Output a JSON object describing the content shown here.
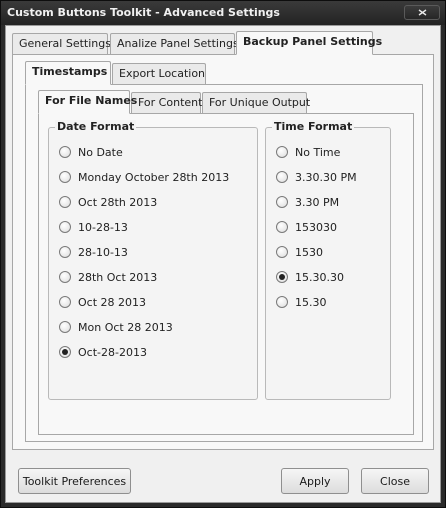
{
  "window": {
    "title": "Custom Buttons Toolkit - Advanced Settings",
    "close_icon": "close-icon"
  },
  "main_tabs": [
    {
      "label": "General Settings",
      "active": false
    },
    {
      "label": "Analize Panel Settings",
      "active": false
    },
    {
      "label": "Backup Panel Settings",
      "active": true
    }
  ],
  "sub_tabs": [
    {
      "label": "Timestamps",
      "active": true
    },
    {
      "label": "Export Location",
      "active": false
    }
  ],
  "inner_tabs": [
    {
      "label": "For File Names",
      "active": true
    },
    {
      "label": "For Content",
      "active": false
    },
    {
      "label": "For Unique Output",
      "active": false
    }
  ],
  "date_format": {
    "title": "Date Format",
    "options": [
      {
        "label": "No Date",
        "checked": false
      },
      {
        "label": "Monday October 28th 2013",
        "checked": false
      },
      {
        "label": "Oct 28th 2013",
        "checked": false
      },
      {
        "label": "10-28-13",
        "checked": false
      },
      {
        "label": "28-10-13",
        "checked": false
      },
      {
        "label": "28th Oct 2013",
        "checked": false
      },
      {
        "label": "Oct 28 2013",
        "checked": false
      },
      {
        "label": "Mon Oct 28 2013",
        "checked": false
      },
      {
        "label": "Oct-28-2013",
        "checked": true
      }
    ]
  },
  "time_format": {
    "title": "Time Format",
    "options": [
      {
        "label": "No Time",
        "checked": false
      },
      {
        "label": "3.30.30 PM",
        "checked": false
      },
      {
        "label": "3.30 PM",
        "checked": false
      },
      {
        "label": "153030",
        "checked": false
      },
      {
        "label": "1530",
        "checked": false
      },
      {
        "label": "15.30.30",
        "checked": true
      },
      {
        "label": "15.30",
        "checked": false
      }
    ]
  },
  "buttons": {
    "preferences": "Toolkit Preferences",
    "apply": "Apply",
    "close": "Close"
  }
}
